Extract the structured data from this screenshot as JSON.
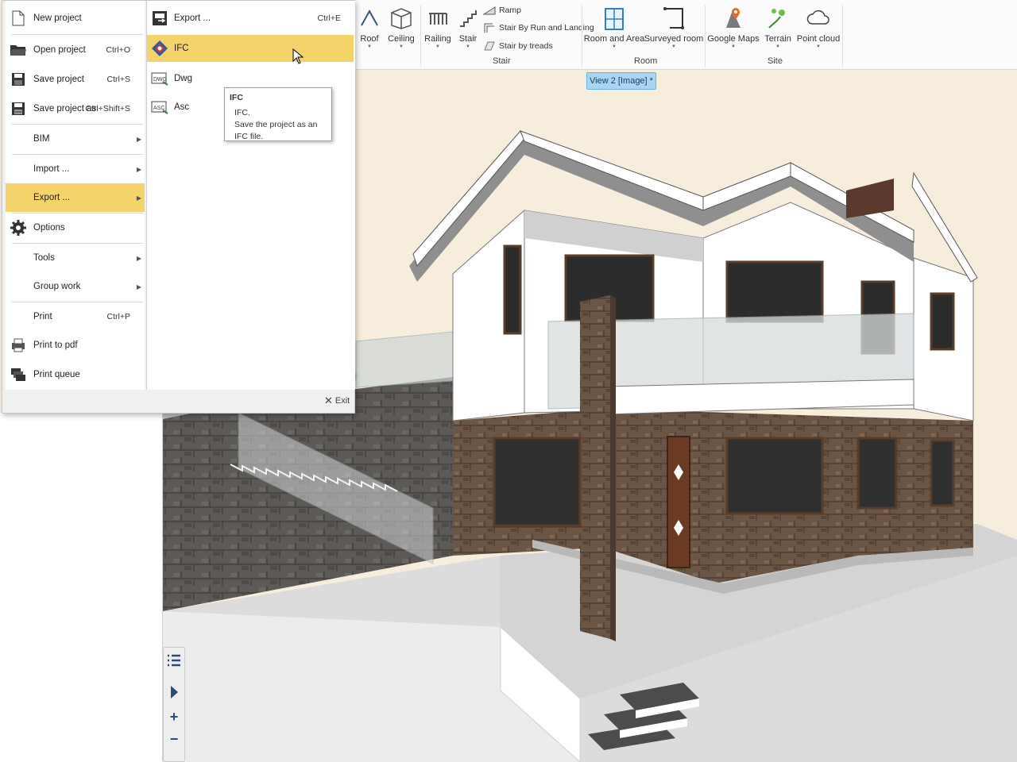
{
  "ribbon": {
    "buttons": [
      {
        "label": "Roof",
        "icon": "roof-icon"
      },
      {
        "label": "Ceiling",
        "icon": "ceiling-icon"
      },
      {
        "label": "Railing",
        "icon": "railing-icon"
      },
      {
        "label": "Stair",
        "icon": "stair-icon"
      },
      {
        "label": "Room and Area",
        "icon": "room-area-icon"
      },
      {
        "label": "Surveyed room",
        "icon": "surveyed-room-icon"
      },
      {
        "label": "Google Maps",
        "icon": "google-maps-icon"
      },
      {
        "label": "Terrain",
        "icon": "terrain-icon"
      },
      {
        "label": "Point cloud",
        "icon": "point-cloud-icon"
      }
    ],
    "stair_small": [
      {
        "label": "Ramp",
        "icon": "ramp-icon"
      },
      {
        "label": "Stair By Run and Landing",
        "icon": "stair-run-landing-icon"
      },
      {
        "label": "Stair by treads",
        "icon": "stair-treads-icon"
      }
    ],
    "groups": {
      "stair": "Stair",
      "room": "Room",
      "site": "Site"
    }
  },
  "view_tab": {
    "label": "View 2 [Image] *"
  },
  "file_menu": {
    "items": [
      {
        "label": "New project",
        "shortcut": "",
        "icon": "new-project-icon"
      },
      {
        "label": "Open project",
        "shortcut": "Ctrl+O",
        "icon": "open-project-icon"
      },
      {
        "label": "Save project",
        "shortcut": "Ctrl+S",
        "icon": "save-project-icon"
      },
      {
        "label": "Save project as",
        "shortcut": "Ctrl+Shift+S",
        "icon": "save-project-as-icon"
      },
      {
        "label": "BIM",
        "shortcut": "",
        "icon": ""
      },
      {
        "label": "Import ...",
        "shortcut": "",
        "icon": ""
      },
      {
        "label": "Export ...",
        "shortcut": "",
        "icon": ""
      },
      {
        "label": "Options",
        "shortcut": "",
        "icon": "gear-icon"
      },
      {
        "label": "Tools",
        "shortcut": "",
        "icon": ""
      },
      {
        "label": "Group work",
        "shortcut": "",
        "icon": ""
      },
      {
        "label": "Print",
        "shortcut": "Ctrl+P",
        "icon": ""
      },
      {
        "label": "Print to pdf",
        "shortcut": "",
        "icon": "print-pdf-icon"
      },
      {
        "label": "Print queue",
        "shortcut": "",
        "icon": "print-queue-icon"
      }
    ],
    "active_item": "Export ...",
    "exit_label": "Exit"
  },
  "export_submenu": {
    "items": [
      {
        "label": "Export ...",
        "shortcut": "Ctrl+E",
        "icon": "export-icon"
      },
      {
        "label": "IFC",
        "shortcut": "",
        "icon": "ifc-icon"
      },
      {
        "label": "Dwg",
        "shortcut": "",
        "icon": "dwg-icon"
      },
      {
        "label": "Asc",
        "shortcut": "",
        "icon": "asc-icon"
      }
    ],
    "active_item": "IFC"
  },
  "tooltip": {
    "title": "IFC",
    "line1": "IFC.",
    "line2": "Save the project as an IFC file."
  },
  "colors": {
    "highlight": "#f3d36a",
    "view_tab": "#a9d5f2",
    "background": "#f7eddd",
    "stone_wall": "#5e5a57",
    "brick_facade": "#6f5848",
    "white_walls": "#ffffff"
  }
}
